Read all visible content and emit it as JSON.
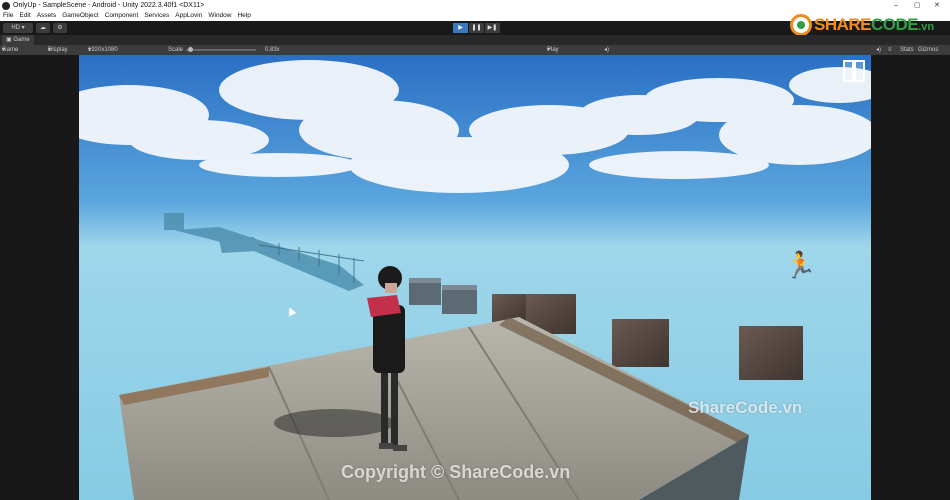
{
  "window": {
    "title": "OnlyUp - SampleScene - Android - Unity 2022.3.40f1 <DX11>",
    "controls": [
      "–",
      "▢",
      "✕"
    ]
  },
  "menu": [
    "File",
    "Edit",
    "Assets",
    "GameObject",
    "Component",
    "Services",
    "AppLovin",
    "Window",
    "Help"
  ],
  "toolbar": {
    "account_label": "HD",
    "play_state": "playing"
  },
  "logo": {
    "brand_prefix": "SHARE",
    "brand_suffix": "CODE",
    "tld": ".vn"
  },
  "game_panel": {
    "tab_label": "Game",
    "view_select": "Game",
    "display_select": "Display 1",
    "resolution_select": "1920x1080 Landscape",
    "scale_label": "Scale",
    "scale_value": "0.83x",
    "play_mode_select": "Play Focused",
    "stats_label": "Stats",
    "gizmos_label": "Gizmos"
  },
  "hud": {
    "pause_icon": "pause-icon",
    "run_icon": "running-person-icon"
  },
  "watermarks": {
    "center": "Copyright © ShareCode.vn",
    "right": "ShareCode.vn"
  },
  "colors": {
    "play_active": "#3a79bb",
    "sky_top": "#2a6fc4",
    "sky_horizon": "#9fd6ea",
    "brand_orange": "#f28b1c",
    "brand_green": "#2f9e44"
  }
}
